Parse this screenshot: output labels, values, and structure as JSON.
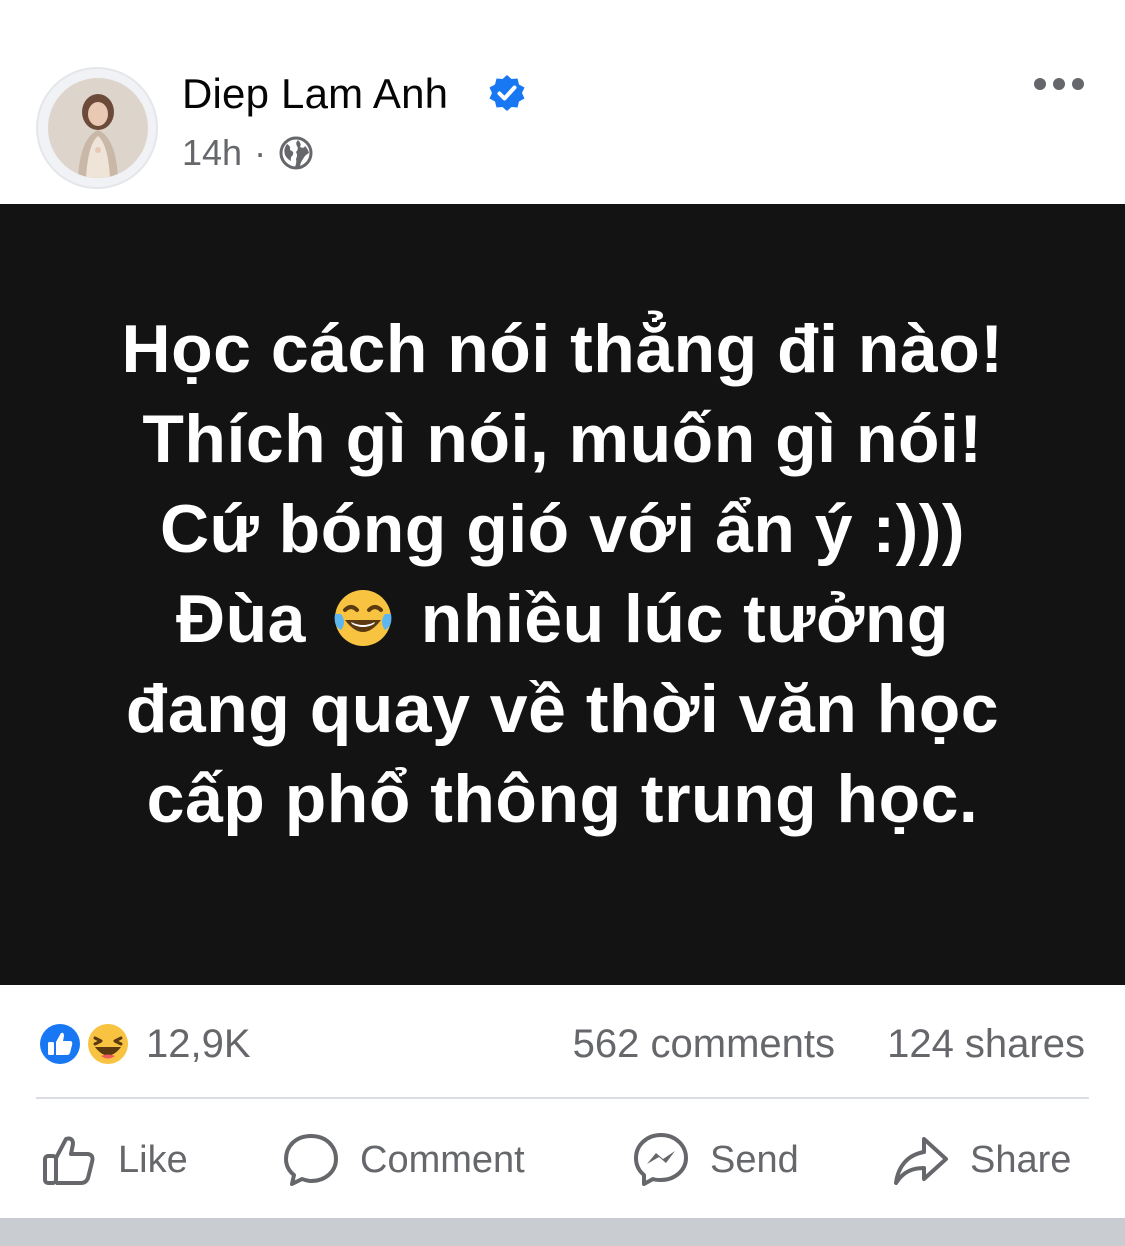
{
  "post": {
    "author": "Diep Lam Anh",
    "time": "14h",
    "separator": "·",
    "privacy_icon": "globe-icon",
    "more_icon": "more-horizontal-icon",
    "verified_icon": "verified-badge-icon",
    "colors": {
      "content_background": "#131313",
      "verified": "#1877f2",
      "meta_text": "#65676b"
    }
  },
  "content": {
    "lines": [
      "Học cách nói thẳng đi nào!",
      "Thích gì nói, muốn gì nói!",
      "Cứ bóng gió với ẩn ý :)))",
      "Đùa",
      "nhiều lúc tưởng",
      "đang quay về thời văn học",
      "cấp phổ thông trung học."
    ],
    "emoji_icon": "laughing-tears-emoji-icon"
  },
  "stats": {
    "reaction_icons": [
      "like-reaction-icon",
      "haha-reaction-icon"
    ],
    "reactions": "12,9K",
    "comments": "562 comments",
    "shares": "124 shares"
  },
  "actions": {
    "like": "Like",
    "comment": "Comment",
    "send": "Send",
    "share": "Share"
  }
}
